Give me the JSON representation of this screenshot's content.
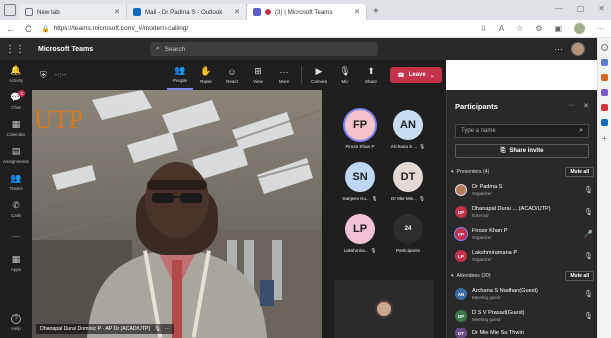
{
  "browser": {
    "tabs": [
      {
        "title": "New tab",
        "icon_color": "#6b7785",
        "active": false
      },
      {
        "title": "Mail - Dr Padma S - Outlook",
        "icon_color": "#0f6cbd",
        "active": false
      },
      {
        "title": "(3) | Microsoft Teams",
        "icon_color": "#5b5fc7",
        "active": true
      }
    ],
    "url": "https://teams.microsoft.com/_#/modern-calling/",
    "newtab_glyph": "+",
    "nav_glyphs": {
      "back": "←",
      "refresh": "C"
    }
  },
  "teams": {
    "app_title": "Microsoft Teams",
    "search_placeholder": "Search",
    "more_glyph": "···"
  },
  "rail": [
    {
      "label": "Activity",
      "icon": "bell-icon",
      "glyph": "🔔",
      "badge": ""
    },
    {
      "label": "Chat",
      "icon": "chat-icon",
      "glyph": "💬",
      "badge": "3"
    },
    {
      "label": "Calendar",
      "icon": "calendar-icon",
      "glyph": "▦",
      "badge": ""
    },
    {
      "label": "Assignments",
      "icon": "assignments-icon",
      "glyph": "▤",
      "badge": ""
    },
    {
      "label": "Teams",
      "icon": "teams-icon",
      "glyph": "👥",
      "badge": ""
    },
    {
      "label": "Calls",
      "icon": "phone-icon",
      "glyph": "✆",
      "badge": ""
    },
    {
      "label": "···",
      "icon": "more-icon",
      "glyph": "",
      "badge": ""
    },
    {
      "label": "Apps",
      "icon": "apps-icon",
      "glyph": "▦",
      "badge": ""
    }
  ],
  "rail_help": {
    "label": "Help",
    "glyph": "?"
  },
  "meeting": {
    "timer": "--:--",
    "buttons": [
      {
        "label": "People",
        "icon": "people-icon",
        "glyph": "👥",
        "active": true
      },
      {
        "label": "Raise",
        "icon": "hand-icon",
        "glyph": "✋",
        "active": false
      },
      {
        "label": "React",
        "icon": "smile-icon",
        "glyph": "☺",
        "active": false
      },
      {
        "label": "View",
        "icon": "grid-icon",
        "glyph": "⊞",
        "active": false
      },
      {
        "label": "More",
        "icon": "more-icon",
        "glyph": "···",
        "active": false
      }
    ],
    "av_buttons": [
      {
        "label": "Camera",
        "icon": "camera-off-icon",
        "glyph": "▶"
      },
      {
        "label": "Mic",
        "icon": "mic-off-icon",
        "glyph": "🎙"
      },
      {
        "label": "Share",
        "icon": "share-icon",
        "glyph": "⬆"
      }
    ],
    "leave_label": "Leave",
    "speaker_label": "Dhanapal Durai Dominic P - AP Dr (ACAD/UTP)",
    "speaker_more": "···",
    "backdrop_text": "UTP"
  },
  "gallery": [
    {
      "initials": "FP",
      "name": "Firoze Khan P",
      "color": "#f7c3c8",
      "ring": true
    },
    {
      "initials": "AN",
      "name": "Archana S ...",
      "color": "#c7dcf1",
      "ring": false
    },
    {
      "initials": "SN",
      "name": "Sanjeev Ku...",
      "color": "#bed8f3",
      "ring": false
    },
    {
      "initials": "DT",
      "name": "Dr Mie Mie...",
      "color": "#e2dad3",
      "ring": false
    },
    {
      "initials": "LP",
      "name": "Lakshmira...",
      "color": "#f3c2d9",
      "ring": false
    },
    {
      "initials": "24",
      "name": "Participants",
      "color": "#2d2d2d",
      "ring": false
    }
  ],
  "panel": {
    "title": "Participants",
    "more_glyph": "···",
    "close_glyph": "✕",
    "search_placeholder": "Type a name",
    "share_invite": "Share invite",
    "presenters_header": "Presenters (4)",
    "attendees_header": "Attendees (20)",
    "mute_all": "Mute all",
    "presenters": [
      {
        "initials": "DP",
        "name": "Dr Padma S",
        "role": "Organizer",
        "color": "#b77a5a",
        "photo": true
      },
      {
        "initials": "DP",
        "name": "Dhanapal Durai ... (ACAD/UTP)",
        "role": "External",
        "color": "#c4314b",
        "photo": false
      },
      {
        "initials": "FP",
        "name": "Firoze Khan P",
        "role": "Organizer",
        "color": "#c4314b",
        "photo": false
      },
      {
        "initials": "LP",
        "name": "Lakshmiramana P",
        "role": "Organizer",
        "color": "#c4314b",
        "photo": false
      }
    ],
    "attendees": [
      {
        "initials": "AN",
        "name": "Archana S Nadhan(Guest)",
        "role": "Meeting guest",
        "color": "#3a6ea5"
      },
      {
        "initials": "DP",
        "name": "D S V Prasad(Guest)",
        "role": "Meeting guest",
        "color": "#3a7a4a"
      },
      {
        "initials": "DT",
        "name": "Dr Mie Mie Su Thwin",
        "role": "",
        "color": "#6b4a8a"
      }
    ]
  },
  "colors": {
    "teams_purple": "#7f85f5",
    "leave_red": "#c4314b",
    "dark_bg": "#1f1f1f",
    "panel_bg": "#292929"
  }
}
